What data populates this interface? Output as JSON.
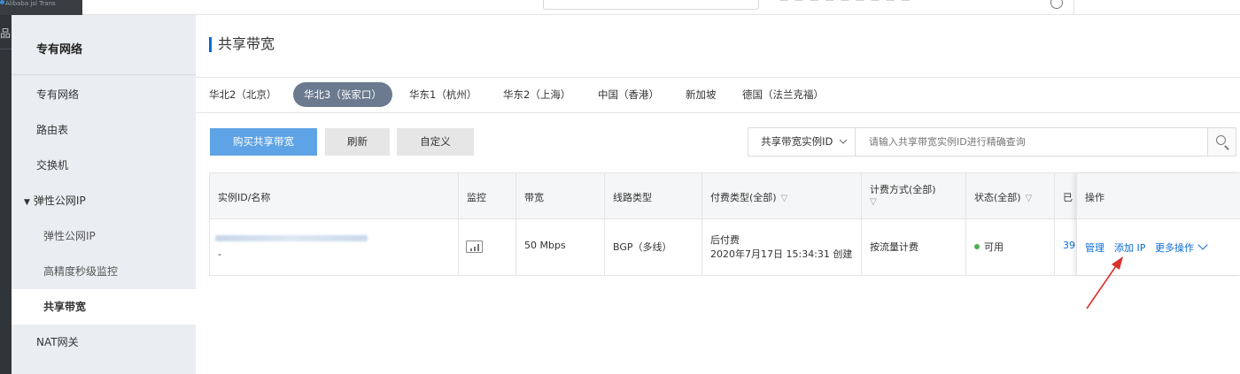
{
  "topbar": {
    "logo_text": "Alibaba jsl Trans"
  },
  "darkstrip": {
    "glyph": "品"
  },
  "sidebar": {
    "title": "专有网络",
    "items": [
      {
        "label": "专有网络"
      },
      {
        "label": "路由表"
      },
      {
        "label": "交换机"
      },
      {
        "label": "弹性公网IP"
      },
      {
        "label": "弹性公网IP"
      },
      {
        "label": "高精度秒级监控"
      },
      {
        "label": "共享带宽"
      },
      {
        "label": "NAT网关"
      }
    ]
  },
  "main": {
    "title": "共享带宽",
    "regions": [
      "华北2（北京）",
      "华北3（张家口）",
      "华东1（杭州）",
      "华东2（上海）",
      "中国（香港）",
      "新加坡",
      "德国（法兰克福）"
    ],
    "active_region_index": 1,
    "buttons": {
      "buy": "购买共享带宽",
      "refresh": "刷新",
      "customize": "自定义"
    },
    "filter": {
      "select_label": "共享带宽实例ID",
      "placeholder": "请输入共享带宽实例ID进行精确查询"
    },
    "table": {
      "headers": {
        "id_name": "实例ID/名称",
        "monitor": "监控",
        "bandwidth": "带宽",
        "line_type": "线路类型",
        "pay_type": "付费类型(全部)",
        "billing_line1": "计费方式(全部)",
        "status": "状态(全部)",
        "added": "已",
        "ops": "操作"
      },
      "rows": [
        {
          "name": "-",
          "bandwidth": "50 Mbps",
          "line_type": "BGP（多线）",
          "pay_type": "后付费",
          "created": "2020年7月17日 15:34:31 创建",
          "billing": "按流量计费",
          "status": "可用",
          "added": "39.",
          "ops": {
            "manage": "管理",
            "add_ip": "添加 IP",
            "more": "更多操作"
          }
        }
      ]
    }
  },
  "colors": {
    "accent": "#0a6cd6",
    "primary_button": "#5ea3e6",
    "active_region": "#6b7a8f",
    "annotation_arrow": "#d9322b",
    "status_ok": "#4caf50"
  }
}
